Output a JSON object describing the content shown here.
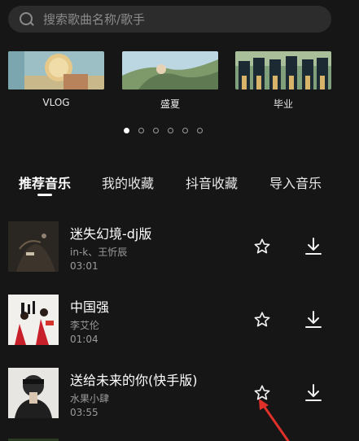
{
  "search": {
    "placeholder": "搜索歌曲名称/歌手",
    "icon": "search-icon"
  },
  "categories": [
    {
      "label": "VLOG"
    },
    {
      "label": "盛夏"
    },
    {
      "label": "毕业"
    }
  ],
  "carousel": {
    "pages": 6,
    "active": 1
  },
  "tabs": [
    {
      "label": "推荐音乐",
      "active": true
    },
    {
      "label": "我的收藏",
      "active": false
    },
    {
      "label": "抖音收藏",
      "active": false
    },
    {
      "label": "导入音乐",
      "active": false
    }
  ],
  "songs": [
    {
      "title": "迷失幻境-dj版",
      "artist": "in-k、王忻辰",
      "duration": "03:01"
    },
    {
      "title": "中国强",
      "artist": "李艾伦",
      "duration": "01:04"
    },
    {
      "title": "送给未来的你(快手版)",
      "artist": "水果小肆",
      "duration": "03:55"
    }
  ],
  "colors": {
    "background": "#161616",
    "search_bg": "#2c2c2c",
    "secondary_text": "#9b9b9b",
    "arrow": "#e0302a"
  }
}
